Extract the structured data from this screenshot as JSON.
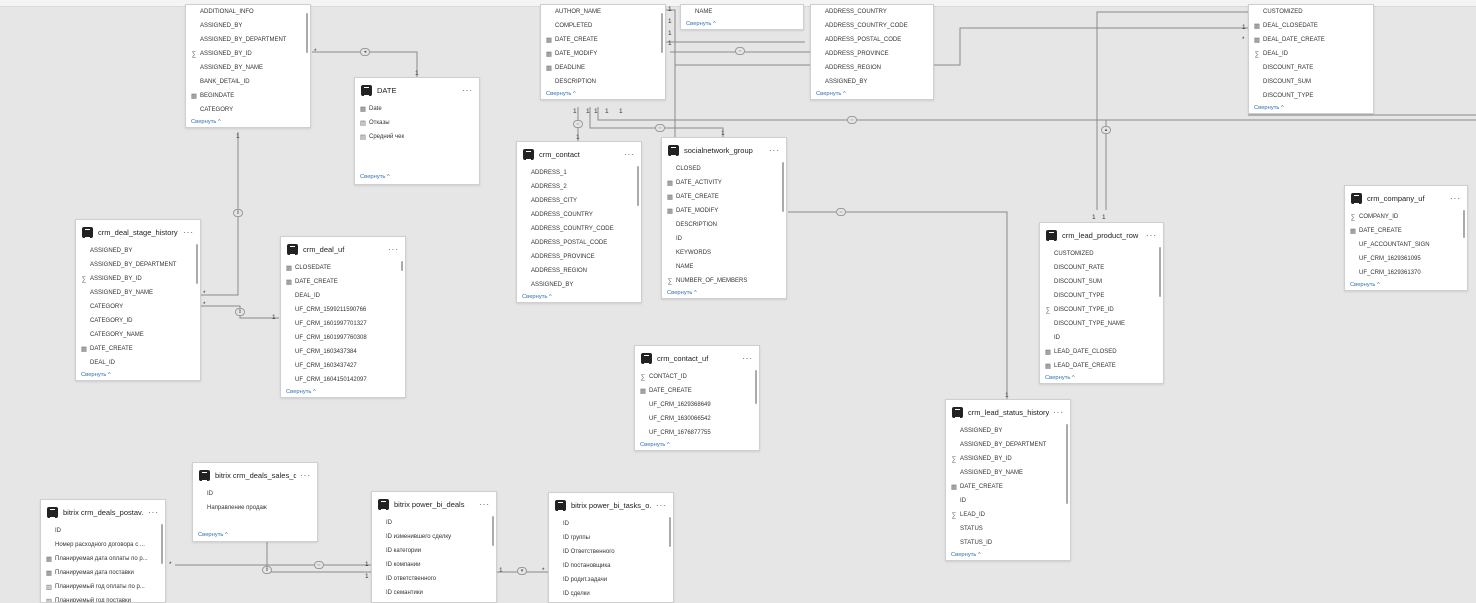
{
  "collapse": "Свернуть ^",
  "more": "···",
  "tables": {
    "t1": {
      "name": "",
      "fields": [
        "ADDITIONAL_INFO",
        "ASSIGNED_BY",
        "ASSIGNED_BY_DEPARTMENT",
        "ASSIGNED_BY_ID",
        "ASSIGNED_BY_NAME",
        "BANK_DETAIL_ID",
        "BEGINDATE",
        "CATEGORY"
      ]
    },
    "date": {
      "name": "DATE",
      "fields": [
        "Date",
        "Отказы",
        "Средний чек"
      ]
    },
    "t3": {
      "name": "",
      "fields": [
        "AUTHOR_NAME",
        "COMPLETED",
        "DATE_CREATE",
        "DATE_MODIFY",
        "DEADLINE",
        "DESCRIPTION"
      ]
    },
    "t4": {
      "name": "",
      "fields": [
        "NAME"
      ]
    },
    "t5": {
      "name": "",
      "fields": [
        "ADDRESS_COUNTRY",
        "ADDRESS_COUNTRY_CODE",
        "ADDRESS_POSTAL_CODE",
        "ADDRESS_PROVINCE",
        "ADDRESS_REGION",
        "ASSIGNED_BY"
      ]
    },
    "t6": {
      "name": "",
      "fields": [
        "CUSTOMIZED",
        "DEAL_CLOSEDATE",
        "DEAL_DATE_CREATE",
        "DEAL_ID",
        "DISCOUNT_RATE",
        "DISCOUNT_SUM",
        "DISCOUNT_TYPE"
      ]
    },
    "crm_contact": {
      "name": "crm_contact",
      "fields": [
        "ADDRESS_1",
        "ADDRESS_2",
        "ADDRESS_CITY",
        "ADDRESS_COUNTRY",
        "ADDRESS_COUNTRY_CODE",
        "ADDRESS_POSTAL_CODE",
        "ADDRESS_PROVINCE",
        "ADDRESS_REGION",
        "ASSIGNED_BY"
      ]
    },
    "socialnetwork_group": {
      "name": "socialnetwork_group",
      "fields": [
        "CLOSED",
        "DATE_ACTIVITY",
        "DATE_CREATE",
        "DATE_MODIFY",
        "DESCRIPTION",
        "ID",
        "KEYWORDS",
        "NAME",
        "NUMBER_OF_MEMBERS"
      ]
    },
    "crm_company_uf": {
      "name": "crm_company_uf",
      "fields": [
        "COMPANY_ID",
        "DATE_CREATE",
        "UF_ACCOUNTANT_SIGN",
        "UF_CRM_1629361095",
        "UF_CRM_1629361370"
      ]
    },
    "crm_deal_stage_history": {
      "name": "crm_deal_stage_history",
      "fields": [
        "ASSIGNED_BY",
        "ASSIGNED_BY_DEPARTMENT",
        "ASSIGNED_BY_ID",
        "ASSIGNED_BY_NAME",
        "CATEGORY",
        "CATEGORY_ID",
        "CATEGORY_NAME",
        "DATE_CREATE",
        "DEAL_ID"
      ]
    },
    "crm_deal_uf": {
      "name": "crm_deal_uf",
      "fields": [
        "CLOSEDATE",
        "DATE_CREATE",
        "DEAL_ID",
        "UF_CRM_1599211590766",
        "UF_CRM_1601997701327",
        "UF_CRM_1601997760308",
        "UF_CRM_1603437384",
        "UF_CRM_1603437427",
        "UF_CRM_1604150142097"
      ]
    },
    "crm_lead_product_row": {
      "name": "crm_lead_product_row",
      "fields": [
        "CUSTOMIZED",
        "DISCOUNT_RATE",
        "DISCOUNT_SUM",
        "DISCOUNT_TYPE",
        "DISCOUNT_TYPE_ID",
        "DISCOUNT_TYPE_NAME",
        "ID",
        "LEAD_DATE_CLOSED",
        "LEAD_DATE_CREATE"
      ]
    },
    "crm_contact_uf": {
      "name": "crm_contact_uf",
      "fields": [
        "CONTACT_ID",
        "DATE_CREATE",
        "UF_CRM_1629368649",
        "UF_CRM_1630066542",
        "UF_CRM_1676877755"
      ]
    },
    "crm_lead_status_history": {
      "name": "crm_lead_status_history",
      "fields": [
        "ASSIGNED_BY",
        "ASSIGNED_BY_DEPARTMENT",
        "ASSIGNED_BY_ID",
        "ASSIGNED_BY_NAME",
        "DATE_CREATE",
        "ID",
        "LEAD_ID",
        "STATUS",
        "STATUS_ID"
      ]
    },
    "sales_dir": {
      "name": "bitrix crm_deals_sales_d...",
      "fields": [
        "ID",
        "Направление продаж"
      ]
    },
    "postav": {
      "name": "bitrix crm_deals_postav...",
      "fields": [
        "ID",
        "Номер расходного договора с ...",
        "Планируемая дата оплаты по р...",
        "Планируемая дата поставки",
        "Планируемый год оплаты по р...",
        "Планируемый год поставки"
      ]
    },
    "power_deals": {
      "name": "bitrix power_bi_deals",
      "fields": [
        "ID",
        "ID изменившего сделку",
        "ID категории",
        "ID компании",
        "ID ответственного",
        "ID семантики"
      ]
    },
    "power_tasks": {
      "name": "bitrix power_bi_tasks_o...",
      "fields": [
        "ID",
        "ID группы",
        "ID Ответственного",
        "ID постановщика",
        "ID родит.задачи",
        "ID сделки"
      ]
    }
  },
  "field_icons": {
    "t1": [
      "",
      "",
      "",
      "sigma",
      "",
      "",
      "calendar",
      ""
    ],
    "date": [
      "calendar",
      "calc",
      "calc"
    ],
    "t3": [
      "",
      "",
      "calendar",
      "calendar",
      "calendar",
      ""
    ],
    "t4": [
      ""
    ],
    "t5": [
      "",
      "",
      "",
      "",
      "",
      ""
    ],
    "t6": [
      "",
      "calendar",
      "calendar",
      "sigma",
      "",
      "",
      ""
    ],
    "crm_contact": [
      "",
      "",
      "",
      "",
      "",
      "",
      "",
      "",
      ""
    ],
    "socialnetwork_group": [
      "",
      "calendar",
      "calendar",
      "calendar",
      "",
      "",
      "",
      "",
      "sigma"
    ],
    "crm_company_uf": [
      "sigma",
      "calendar",
      "",
      "",
      ""
    ],
    "crm_deal_stage_history": [
      "",
      "",
      "sigma",
      "",
      "",
      "",
      "",
      "calendar",
      ""
    ],
    "crm_deal_uf": [
      "calendar",
      "calendar",
      "",
      "",
      "",
      "",
      "",
      "",
      ""
    ],
    "crm_lead_product_row": [
      "",
      "",
      "",
      "",
      "sigma",
      "",
      "",
      "calendar",
      "calendar"
    ],
    "crm_contact_uf": [
      "sigma",
      "calendar",
      "",
      "",
      ""
    ],
    "crm_lead_status_history": [
      "",
      "",
      "sigma",
      "",
      "calendar",
      "",
      "sigma",
      "",
      ""
    ],
    "sales_dir": [
      "",
      ""
    ],
    "postav": [
      "",
      "",
      "calendar",
      "calendar",
      "table",
      "table"
    ],
    "power_deals": [
      "",
      "",
      "",
      "",
      "",
      ""
    ],
    "power_tasks": [
      "",
      "",
      "",
      "",
      "",
      ""
    ]
  },
  "cardinality": {
    "one": "1",
    "many": "*"
  }
}
